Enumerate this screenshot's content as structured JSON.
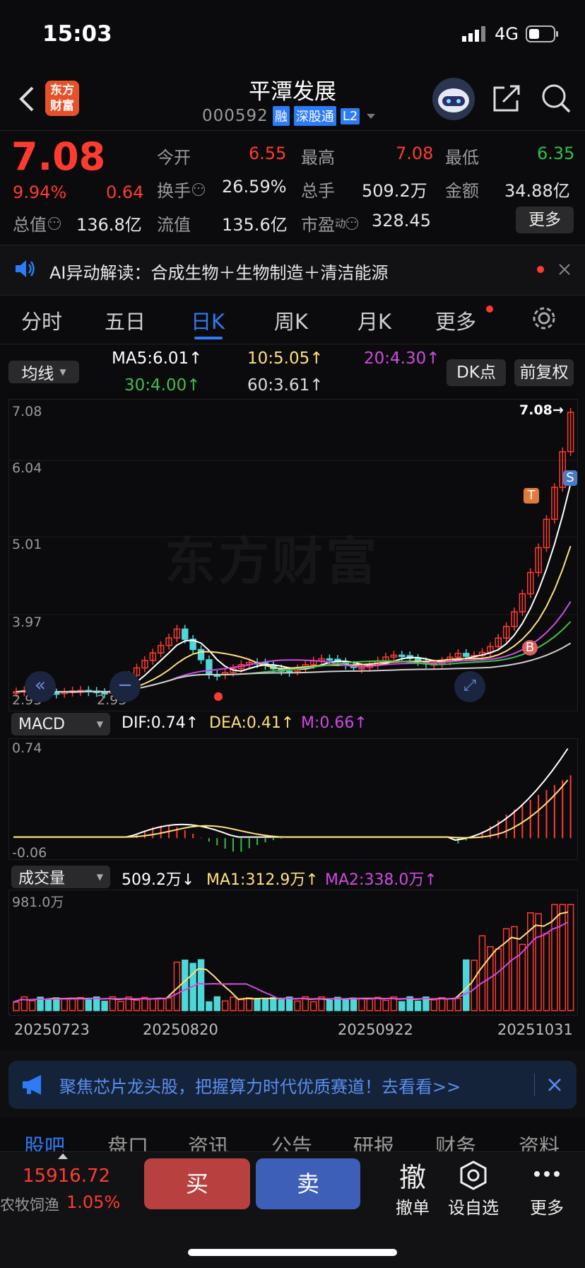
{
  "status": {
    "time": "15:03",
    "network": "4G"
  },
  "header": {
    "title": "平潭发展",
    "code": "000592",
    "tags": [
      "融",
      "深股通",
      "L2"
    ],
    "logo_line1": "东方",
    "logo_line2": "财富"
  },
  "quote": {
    "price": "7.08",
    "pct": "9.94%",
    "chg": "0.64",
    "open_label": "今开",
    "open": "6.55",
    "high_label": "最高",
    "high": "7.08",
    "low_label": "最低",
    "low": "6.35",
    "turnover_label": "换手",
    "turnover": "26.59%",
    "volume_label": "总手",
    "volume": "509.2万",
    "amount_label": "金额",
    "amount": "34.88亿",
    "mcap_label": "总值",
    "mcap": "136.8亿",
    "float_label": "流值",
    "float": "135.6亿",
    "pe_label": "市盈",
    "pe_sup": "动",
    "pe": "328.45",
    "more": "更多"
  },
  "ai": {
    "prefix": "AI异动解读：",
    "text": "合成生物＋生物制造＋清洁能源"
  },
  "tabs": [
    "分时",
    "五日",
    "日K",
    "周K",
    "月K",
    "更多"
  ],
  "active_tab": "日K",
  "ma_bar": {
    "selector": "均线",
    "ma5": "MA5:6.01↑",
    "ma10": "10:5.05↑",
    "ma20": "20:4.30↑",
    "ma30": "30:4.00↑",
    "ma60": "60:3.61↑",
    "dk": "DK点",
    "fq": "前复权"
  },
  "price_axis": [
    "7.08",
    "6.04",
    "5.01",
    "3.97",
    "2.93"
  ],
  "price_low_marker": "2.93",
  "last_label": "7.08→",
  "watermark": "东方财富",
  "markers": {
    "b": "B",
    "t": "T",
    "s": "S"
  },
  "macd": {
    "selector": "MACD",
    "dif": "DIF:0.74↑",
    "dea": "DEA:0.41↑",
    "m": "M:0.66↑",
    "top": "0.74",
    "bottom": "-0.06"
  },
  "vol": {
    "selector": "成交量",
    "v": "509.2万↓",
    "ma1": "MA1:312.9万↑",
    "ma2": "MA2:338.0万↑",
    "top": "981.0万"
  },
  "dates": [
    "20250723",
    "20250820",
    "20250922",
    "20251031"
  ],
  "banner": {
    "text": "聚焦芯片龙头股，把握算力时代优质赛道！去看看>>"
  },
  "bottom_tabs": [
    "股吧",
    "盘口",
    "资讯",
    "公告",
    "研报",
    "财务",
    "资料"
  ],
  "footer": {
    "index_value": "15916.72",
    "index_name": "农牧饲渔",
    "index_pct": "1.05%",
    "buy": "买",
    "sell": "卖",
    "cancel_glyph": "撤",
    "cancel": "撤单",
    "watch": "设自选",
    "more": "更多"
  },
  "chart_data": {
    "type": "candlestick",
    "title": "平潭发展 日K",
    "x_start": "20250723",
    "x_end": "20251031",
    "ylim": [
      2.93,
      7.08
    ],
    "last_close": 7.08,
    "ma": {
      "MA5": 6.01,
      "MA10": 5.05,
      "MA20": 4.3,
      "MA30": 4.0,
      "MA60": 3.61
    },
    "macd": {
      "DIF": 0.74,
      "DEA": 0.41,
      "M": 0.66,
      "range": [
        -0.06,
        0.74
      ]
    },
    "volume": {
      "last": "509.2万",
      "MA1": "312.9万",
      "MA2": "338.0万",
      "max": "981.0万"
    }
  },
  "colors": {
    "up": "#ff3b30",
    "down": "#4fd6d8",
    "accent": "#2e7bf6",
    "ma5": "#ffffff",
    "ma10": "#ffe07a",
    "ma20": "#d04be0",
    "ma30": "#3fbf4f",
    "ma60": "#cfcfcf"
  }
}
